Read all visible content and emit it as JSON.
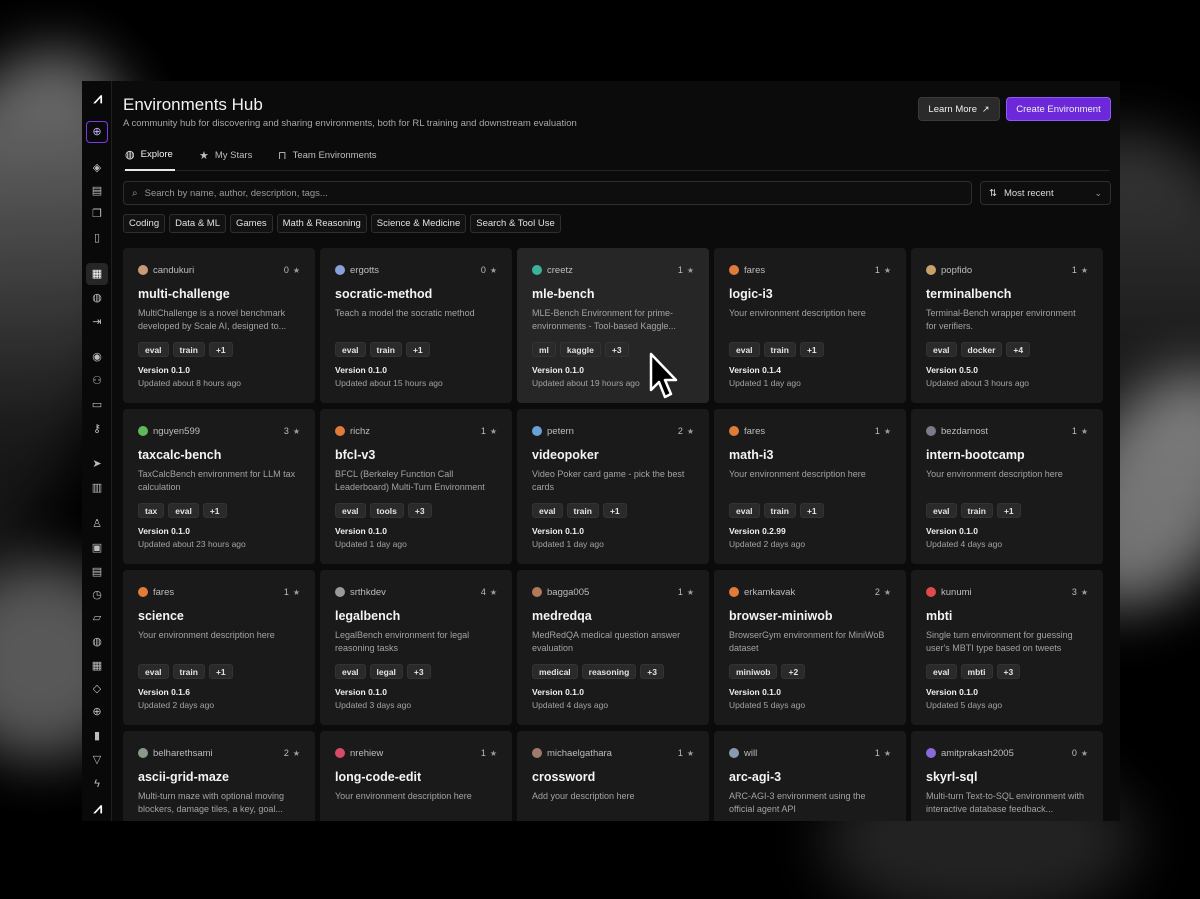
{
  "colors": {
    "accent": "#6d28d9",
    "window_bg": "#0b0b0b",
    "card_bg": "#1a1a1a"
  },
  "header": {
    "title": "Environments Hub",
    "subtitle": "A community hub for discovering and sharing environments, both for RL training and downstream evaluation",
    "learn_more": "Learn More",
    "create": "Create Environment"
  },
  "tabs": [
    {
      "label": "Explore",
      "icon": "globe-icon"
    },
    {
      "label": "My Stars",
      "icon": "star-icon"
    },
    {
      "label": "Team Environments",
      "icon": "lock-icon"
    }
  ],
  "search": {
    "placeholder": "Search by name, author, description, tags..."
  },
  "sort": {
    "label": "Most recent"
  },
  "filters": [
    "Coding",
    "Data & ML",
    "Games",
    "Math & Reasoning",
    "Science & Medicine",
    "Search & Tool Use"
  ],
  "cards": [
    {
      "author": "candukuri",
      "stars": "0",
      "avatar": "#c99a7a",
      "name": "multi-challenge",
      "desc": "MultiChallenge is a novel benchmark developed by Scale AI, designed to...",
      "tags": [
        "eval",
        "train",
        "+1"
      ],
      "version": "Version 0.1.0",
      "updated": "Updated about 8 hours ago"
    },
    {
      "author": "ergotts",
      "stars": "0",
      "avatar": "#8aa0d8",
      "name": "socratic-method",
      "desc": "Teach a model the socratic method",
      "tags": [
        "eval",
        "train",
        "+1"
      ],
      "version": "Version 0.1.0",
      "updated": "Updated about 15 hours ago"
    },
    {
      "author": "creetz",
      "stars": "1",
      "avatar": "#3bb39b",
      "name": "mle-bench",
      "desc": "MLE-Bench Environment for prime-environments - Tool-based Kaggle...",
      "tags": [
        "ml",
        "kaggle",
        "+3"
      ],
      "version": "Version 0.1.0",
      "updated": "Updated about 19 hours ago"
    },
    {
      "author": "fares",
      "stars": "1",
      "avatar": "#e07b39",
      "name": "logic-i3",
      "desc": "Your environment description here",
      "tags": [
        "eval",
        "train",
        "+1"
      ],
      "version": "Version 0.1.4",
      "updated": "Updated 1 day ago"
    },
    {
      "author": "popfido",
      "stars": "1",
      "avatar": "#c9a06a",
      "name": "terminalbench",
      "desc": "Terminal-Bench wrapper environment for verifiers.",
      "tags": [
        "eval",
        "docker",
        "+4"
      ],
      "version": "Version 0.5.0",
      "updated": "Updated about 3 hours ago"
    },
    {
      "author": "nguyen599",
      "stars": "3",
      "avatar": "#5fb95a",
      "name": "taxcalc-bench",
      "desc": "TaxCalcBench environment for LLM tax calculation",
      "tags": [
        "tax",
        "eval",
        "+1"
      ],
      "version": "Version 0.1.0",
      "updated": "Updated about 23 hours ago"
    },
    {
      "author": "richz",
      "stars": "1",
      "avatar": "#e07b39",
      "name": "bfcl-v3",
      "desc": "BFCL (Berkeley Function Call Leaderboard) Multi-Turn Environment",
      "tags": [
        "eval",
        "tools",
        "+3"
      ],
      "version": "Version 0.1.0",
      "updated": "Updated 1 day ago"
    },
    {
      "author": "petern",
      "stars": "2",
      "avatar": "#6a9fd8",
      "name": "videopoker",
      "desc": "Video Poker card game - pick the best cards",
      "tags": [
        "eval",
        "train",
        "+1"
      ],
      "version": "Version 0.1.0",
      "updated": "Updated 1 day ago"
    },
    {
      "author": "fares",
      "stars": "1",
      "avatar": "#e07b39",
      "name": "math-i3",
      "desc": "Your environment description here",
      "tags": [
        "eval",
        "train",
        "+1"
      ],
      "version": "Version 0.2.99",
      "updated": "Updated 2 days ago"
    },
    {
      "author": "bezdarnost",
      "stars": "1",
      "avatar": "#7a7a8a",
      "name": "intern-bootcamp",
      "desc": "Your environment description here",
      "tags": [
        "eval",
        "train",
        "+1"
      ],
      "version": "Version 0.1.0",
      "updated": "Updated 4 days ago"
    },
    {
      "author": "fares",
      "stars": "1",
      "avatar": "#e07b39",
      "name": "science",
      "desc": "Your environment description here",
      "tags": [
        "eval",
        "train",
        "+1"
      ],
      "version": "Version 0.1.6",
      "updated": "Updated 2 days ago"
    },
    {
      "author": "srthkdev",
      "stars": "4",
      "avatar": "#9a9a9a",
      "name": "legalbench",
      "desc": "LegalBench environment for legal reasoning tasks",
      "tags": [
        "eval",
        "legal",
        "+3"
      ],
      "version": "Version 0.1.0",
      "updated": "Updated 3 days ago"
    },
    {
      "author": "bagga005",
      "stars": "1",
      "avatar": "#b07a5a",
      "name": "medredqa",
      "desc": "MedRedQA medical question answer evaluation",
      "tags": [
        "medical",
        "reasoning",
        "+3"
      ],
      "version": "Version 0.1.0",
      "updated": "Updated 4 days ago"
    },
    {
      "author": "erkamkavak",
      "stars": "2",
      "avatar": "#e07b39",
      "name": "browser-miniwob",
      "desc": "BrowserGym environment for MiniWoB dataset",
      "tags": [
        "miniwob",
        "+2"
      ],
      "version": "Version 0.1.0",
      "updated": "Updated 5 days ago"
    },
    {
      "author": "kunumi",
      "stars": "3",
      "avatar": "#e04a4a",
      "name": "mbti",
      "desc": "Single turn environment for guessing user's MBTI type based on tweets",
      "tags": [
        "eval",
        "mbti",
        "+3"
      ],
      "version": "Version 0.1.0",
      "updated": "Updated 5 days ago"
    },
    {
      "author": "belharethsami",
      "stars": "2",
      "avatar": "#8a9a8a",
      "name": "ascii-grid-maze",
      "desc": "Multi-turn maze with optional moving blockers, damage tiles, a key, goal...",
      "tags": [],
      "version": "",
      "updated": ""
    },
    {
      "author": "nrehiew",
      "stars": "1",
      "avatar": "#d84a6a",
      "name": "long-code-edit",
      "desc": "Your environment description here",
      "tags": [],
      "version": "",
      "updated": ""
    },
    {
      "author": "michaelgathara",
      "stars": "1",
      "avatar": "#a07a6a",
      "name": "crossword",
      "desc": "Add your description here",
      "tags": [],
      "version": "",
      "updated": ""
    },
    {
      "author": "will",
      "stars": "1",
      "avatar": "#8a9ab0",
      "name": "arc-agi-3",
      "desc": "ARC-AGI-3 environment using the official agent API",
      "tags": [],
      "version": "",
      "updated": ""
    },
    {
      "author": "amitprakash2005",
      "stars": "0",
      "avatar": "#8a6ad8",
      "name": "skyrl-sql",
      "desc": "Multi-turn Text-to-SQL environment with interactive database feedback...",
      "tags": [],
      "version": "",
      "updated": ""
    }
  ],
  "sidebar_icons": [
    "logo-icon",
    "new-environment-icon",
    "layers-icon",
    "server-icon",
    "copy-icon",
    "file-icon",
    "environments-grid-icon",
    "globe-icon",
    "logout-icon",
    "user-circle-icon",
    "users-icon",
    "card-icon",
    "key-icon",
    "send-icon",
    "book-icon",
    "profile-icon",
    "briefcase-icon",
    "database-icon",
    "clock-icon",
    "inbox-icon",
    "globe-alt-icon",
    "apps-icon",
    "tag-icon",
    "world-icon",
    "chart-icon",
    "filter-icon",
    "bolt-icon",
    "logo-bottom-icon"
  ]
}
